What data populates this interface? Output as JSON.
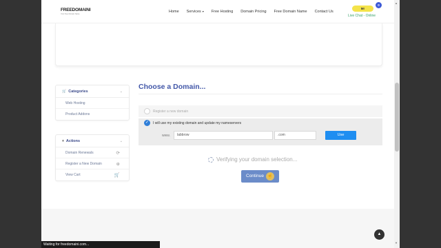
{
  "header": {
    "logo": "FREEDOMAINI",
    "logo_sub": "Your Free Domain Name",
    "nav": [
      "Home",
      "Services",
      "Free Hosting",
      "Domain Pricing",
      "Free Domain Name",
      "Contact Us"
    ],
    "account_label": "Mr",
    "badge_count": "0",
    "live_chat": "Live Chat - Online"
  },
  "sidebar": {
    "categories": {
      "title": "Categories",
      "items": [
        "Web Hosting",
        "Product Addons"
      ]
    },
    "actions": {
      "title": "Actions",
      "items": [
        "Domain Renewals",
        "Register a New Domain",
        "View Cart"
      ]
    }
  },
  "main": {
    "title": "Choose a Domain...",
    "option_register": "Register a new domain",
    "option_existing": "I will use my existing domain and update my nameservers",
    "www_label": "www.",
    "sld_value": "labbrow",
    "tld_value": ".com",
    "use_button": "Use",
    "verifying": "Verifying your domain selection...",
    "continue_button": "Continue"
  },
  "status_bar": "Waiting for freedomaini.com..."
}
